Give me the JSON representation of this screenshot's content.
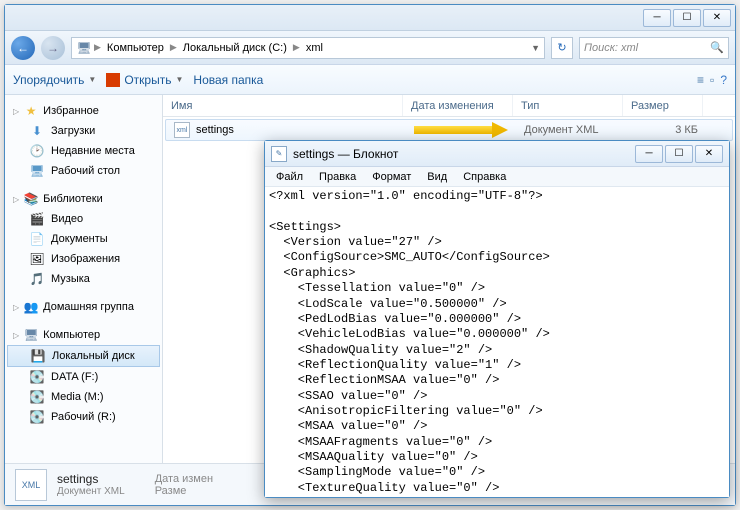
{
  "explorer": {
    "breadcrumb": [
      "Компьютер",
      "Локальный диск (C:)",
      "xml"
    ],
    "search_placeholder": "Поиск: xml",
    "toolbar": {
      "organize": "Упорядочить",
      "open": "Открыть",
      "new_folder": "Новая папка"
    },
    "sidebar": {
      "favorites": {
        "label": "Избранное",
        "items": [
          "Загрузки",
          "Недавние места",
          "Рабочий стол"
        ]
      },
      "libraries": {
        "label": "Библиотеки",
        "items": [
          "Видео",
          "Документы",
          "Изображения",
          "Музыка"
        ]
      },
      "homegroup": {
        "label": "Домашняя группа"
      },
      "computer": {
        "label": "Компьютер",
        "items": [
          "Локальный диск",
          "DATA (F:)",
          "Media (M:)",
          "Рабочий (R:)"
        ]
      }
    },
    "columns": {
      "name": "Имя",
      "modified": "Дата изменения",
      "type": "Тип",
      "size": "Размер"
    },
    "file": {
      "name": "settings",
      "type": "Документ XML",
      "size": "3 КБ"
    },
    "details": {
      "name": "settings",
      "type": "Документ XML",
      "modified_label": "Дата измен",
      "size_label": "Разме"
    }
  },
  "notepad": {
    "title": "settings — Блокнот",
    "menu": [
      "Файл",
      "Правка",
      "Формат",
      "Вид",
      "Справка"
    ],
    "content": "<?xml version=\"1.0\" encoding=\"UTF-8\"?>\n\n<Settings>\n  <Version value=\"27\" />\n  <ConfigSource>SMC_AUTO</ConfigSource>\n  <Graphics>\n    <Tessellation value=\"0\" />\n    <LodScale value=\"0.500000\" />\n    <PedLodBias value=\"0.000000\" />\n    <VehicleLodBias value=\"0.000000\" />\n    <ShadowQuality value=\"2\" />\n    <ReflectionQuality value=\"1\" />\n    <ReflectionMSAA value=\"0\" />\n    <SSAO value=\"0\" />\n    <AnisotropicFiltering value=\"0\" />\n    <MSAA value=\"0\" />\n    <MSAAFragments value=\"0\" />\n    <MSAAQuality value=\"0\" />\n    <SamplingMode value=\"0\" />\n    <TextureQuality value=\"0\" />\n    <ParticleQuality value=\"1\" />\n    <WaterQuality value=\"1\" />\n    <GrassQuality value=\"1\" />"
  }
}
